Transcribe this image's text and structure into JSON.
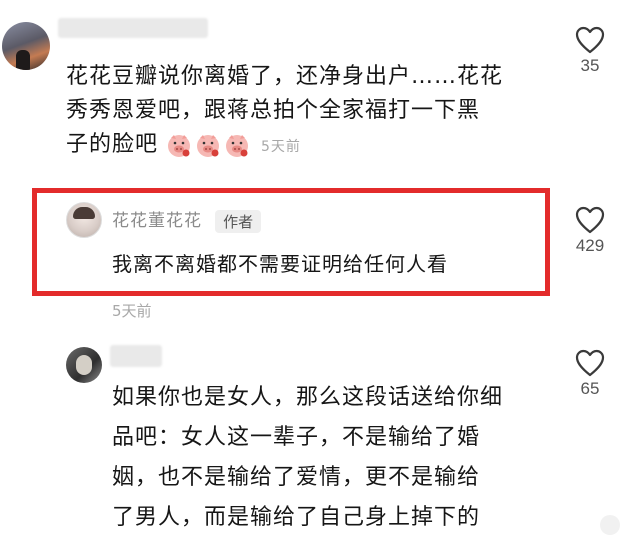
{
  "comment1": {
    "text_line1": "花花豆瓣说你离婚了，还净身出户……花花",
    "text_line2": "秀秀恩爱吧，跟蒋总拍个全家福打一下黑",
    "text_line3": "子的脸吧",
    "time": "5天前",
    "likes": "35"
  },
  "reply": {
    "author": "花花董花花",
    "author_tag": "作者",
    "text": "我离不离婚都不需要证明给任何人看",
    "time": "5天前",
    "likes": "429",
    "highlight_color": "#e32b2b"
  },
  "comment2": {
    "text_line1": "如果你也是女人，那么这段话送给你细",
    "text_line2": "品吧：女人这一辈子，不是输给了婚",
    "text_line3": "姻，也不是输给了爱情，更不是输给",
    "text_line4": "了男人，而是输给了自己身上掉下的",
    "likes": "65"
  }
}
